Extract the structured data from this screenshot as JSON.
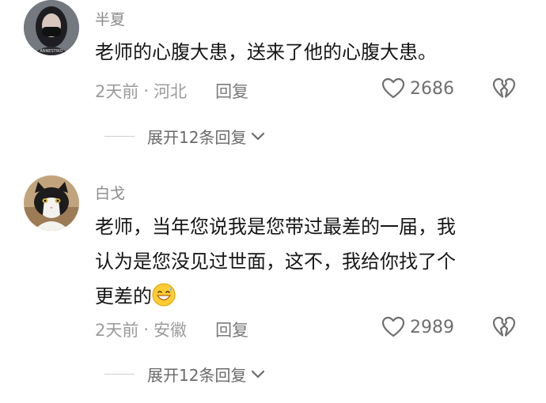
{
  "comments": [
    {
      "username": "半夏",
      "text": "老师的心腹大患，送来了他的心腹大患。",
      "time": "2天前",
      "dot": "·",
      "location": "河北",
      "reply_label": "回复",
      "likes": "2686",
      "expand_label": "展开12条回复",
      "avatar_icon": "woman-masked-avatar",
      "avatar_caption": "ANNESTWO"
    },
    {
      "username": "白戈",
      "text_line1": "老师，当年您说我是您带过最差的一届，我",
      "text_line2": "认为是您没见过世面，这不，我给你找了个",
      "text_line3": "更差的",
      "emoji": "grinning-sweat-emoji",
      "time": "2天前",
      "dot": "·",
      "location": "安徽",
      "reply_label": "回复",
      "likes": "2989",
      "expand_label": "展开12条回复",
      "avatar_icon": "cat-avatar"
    }
  ],
  "colors": {
    "text": "#161616",
    "meta": "#9b9b9b",
    "username": "#8a8a8a"
  }
}
